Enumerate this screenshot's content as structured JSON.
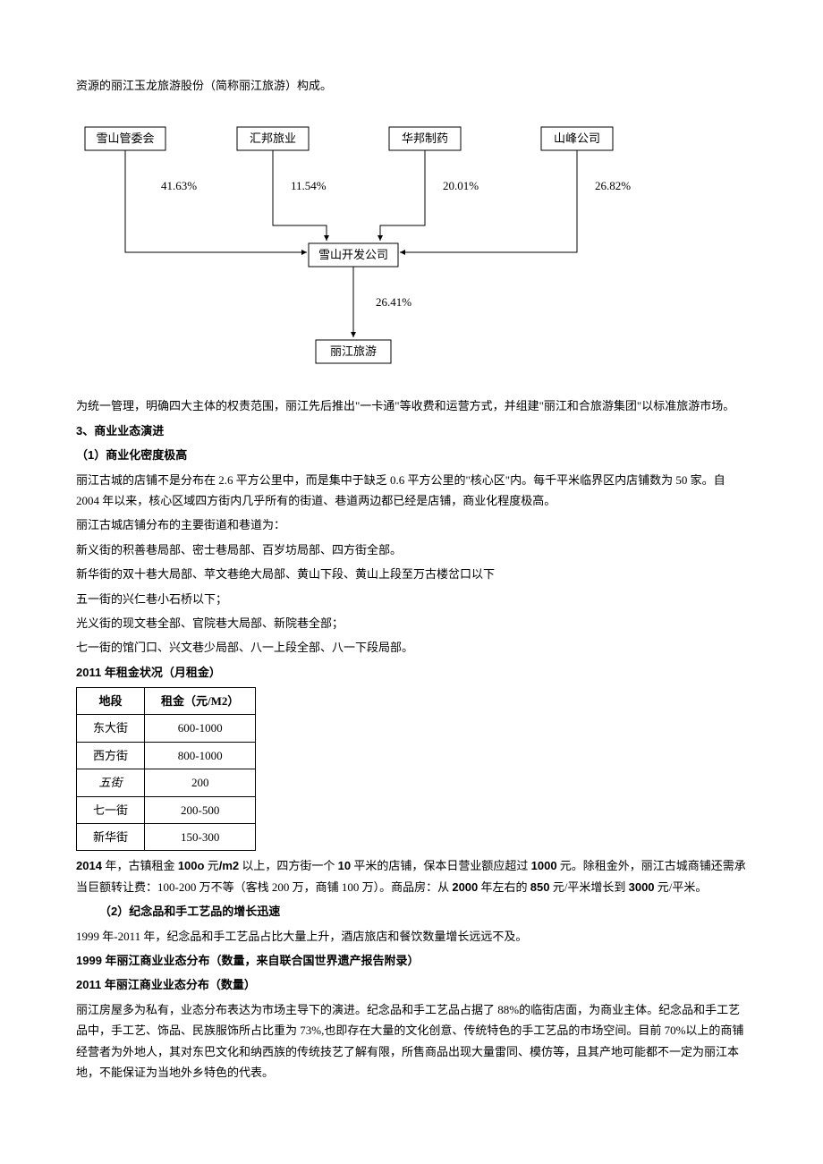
{
  "intro": "资源的丽江玉龙旅游股份（简称丽江旅游）构成。",
  "chart_data": {
    "type": "diagram",
    "nodes_top": [
      {
        "label": "雪山管委会",
        "pct": "41.63%"
      },
      {
        "label": "汇邦旅业",
        "pct": "11.54%"
      },
      {
        "label": "华邦制药",
        "pct": "20.01%"
      },
      {
        "label": "山峰公司",
        "pct": "26.82%"
      }
    ],
    "node_mid": "雪山开发公司",
    "mid_pct": "26.41%",
    "node_bot": "丽江旅游"
  },
  "p_after_diagram": "为统一管理，明确四大主体的权责范围，丽江先后推出\"一卡通\"等收费和运营方式，并组建\"丽江和合旅游集团\"以标准旅游市场。",
  "h3": "3、商业业态演进",
  "h3_1": "（1）商业化密度极高",
  "para1": "丽江古城的店铺不是分布在 2.6 平方公里中，而是集中于缺乏 0.6 平方公里的\"核心区\"内。每千平米临界区内店铺数为 50 家。自 2004 年以来，核心区域四方街内几乎所有的街道、巷道两边都已经是店铺，商业化程度极高。",
  "para2": "丽江古城店铺分布的主要街道和巷道为：",
  "streets": [
    "新义街的积善巷局部、密士巷局部、百岁坊局部、四方街全部。",
    "新华街的双十巷大局部、苹文巷绝大局部、黄山下段、黄山上段至万古楼岔口以下",
    "五一街的兴仁巷小石桥以下；",
    "光义街的现文巷全部、官院巷大局部、新院巷全部；",
    "七一街的馆门口、兴文巷少局部、八一上段全部、八一下段局部。"
  ],
  "rent_heading": "2011 年租金状况（月租金）",
  "rent_table": {
    "headers": [
      "地段",
      "租金（元/M2）"
    ],
    "rows": [
      [
        "东大街",
        "600-1000"
      ],
      [
        "西方街",
        "800-1000"
      ],
      [
        "五街",
        "200"
      ],
      [
        "七一街",
        "200-500"
      ],
      [
        "新华街",
        "150-300"
      ]
    ]
  },
  "para_2014_pre": "2014 ",
  "para_2014_mid1": "年，古镇租金 ",
  "para_2014_b1": "100o",
  "para_2014_mid2": " 元",
  "para_2014_b2": "/m2",
  "para_2014_mid3": " 以上，四方街一个 ",
  "para_2014_b3": "10",
  "para_2014_mid4": " 平米的店铺，保本日营业额应超过 ",
  "para_2014_b4": "1000",
  "para_2014_mid5": " 元。除租金外，丽江古城商铺还需承当巨额转让费：100-200 万不等（客栈 200 万，商铺 100 万）。商品房：从 ",
  "para_2014_b5": "2000",
  "para_2014_mid6": " 年左右的 ",
  "para_2014_b6": "850",
  "para_2014_mid7": " 元/平米增长到 ",
  "para_2014_b7": "3000",
  "para_2014_mid8": " 元/平米。",
  "h3_2": "（2）纪念品和手工艺品的增长迅速",
  "para5": "1999 年-2011 年，纪念品和手工艺品占比大量上升，酒店旅店和餐饮数量增长远远不及。",
  "para6": "1999 年丽江商业业态分布（数量，来自联合国世界遗产报告附录）",
  "para7": "2011 年丽江商业业态分布（数量）",
  "para8": "丽江房屋多为私有，业态分布表达为市场主导下的演进。纪念品和手工艺品占据了 88%的临街店面，为商业主体。纪念品和手工艺品中，手工艺、饰品、民族服饰所占比重为 73%,也即存在大量的文化创意、传统特色的手工艺品的市场空间。目前 70%以上的商铺经营者为外地人，其对东巴文化和纳西族的传统技艺了解有限，所售商品出现大量雷同、模仿等，且其产地可能都不一定为丽江本地，不能保证为当地外乡特色的代表。"
}
